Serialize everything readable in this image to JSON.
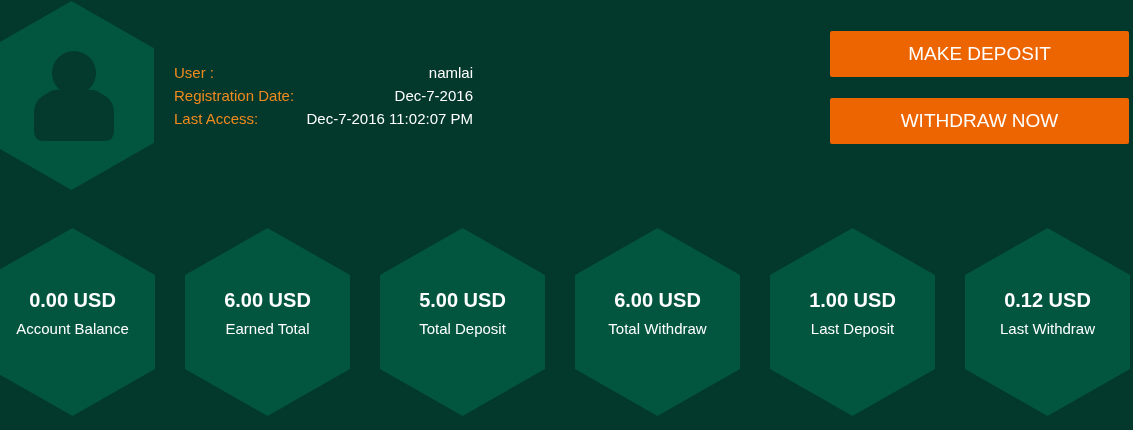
{
  "profile": {
    "fields": [
      {
        "label": "User :",
        "value": "namlai"
      },
      {
        "label": "Registration Date:",
        "value": "Dec-7-2016"
      },
      {
        "label": "Last Access:",
        "value": "Dec-7-2016 11:02:07 PM"
      }
    ]
  },
  "buttons": [
    {
      "label": "MAKE DEPOSIT"
    },
    {
      "label": "WITHDRAW NOW"
    }
  ],
  "stats": [
    {
      "value": "0.00 USD",
      "label": "Account Balance"
    },
    {
      "value": "6.00 USD",
      "label": "Earned Total"
    },
    {
      "value": "5.00 USD",
      "label": "Total Deposit"
    },
    {
      "value": "6.00 USD",
      "label": "Total Withdraw"
    },
    {
      "value": "1.00 USD",
      "label": "Last Deposit"
    },
    {
      "value": "0.12 USD",
      "label": "Last Withdraw"
    }
  ]
}
